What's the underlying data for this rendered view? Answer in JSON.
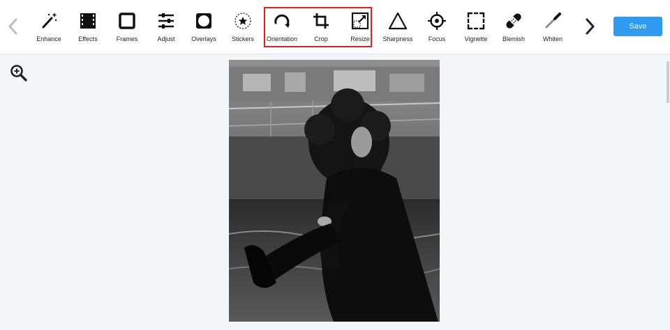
{
  "toolbar": {
    "tools": [
      {
        "label": "Enhance",
        "icon": "magic-wand-icon"
      },
      {
        "label": "Effects",
        "icon": "film-icon"
      },
      {
        "label": "Frames",
        "icon": "frame-icon"
      },
      {
        "label": "Adjust",
        "icon": "sliders-icon"
      },
      {
        "label": "Overlays",
        "icon": "overlay-icon"
      },
      {
        "label": "Stickers",
        "icon": "star-sticker-icon"
      },
      {
        "label": "Orientation",
        "icon": "rotate-icon"
      },
      {
        "label": "Crop",
        "icon": "crop-icon"
      },
      {
        "label": "Resize",
        "icon": "resize-icon"
      },
      {
        "label": "Sharpness",
        "icon": "triangle-icon"
      },
      {
        "label": "Focus",
        "icon": "crosshair-icon"
      },
      {
        "label": "Vignette",
        "icon": "vignette-icon"
      },
      {
        "label": "Blemish",
        "icon": "bandage-icon"
      },
      {
        "label": "Whiten",
        "icon": "brush-icon"
      }
    ],
    "highlighted_tools": [
      "Orientation",
      "Crop",
      "Resize"
    ],
    "save_label": "Save"
  },
  "colors": {
    "accent": "#2f9bf0",
    "highlight_border": "#e02020",
    "workspace_bg": "#f3f6f8"
  },
  "canvas": {
    "image": "black-and-white photo of a woman with curly hair sitting by the water"
  }
}
